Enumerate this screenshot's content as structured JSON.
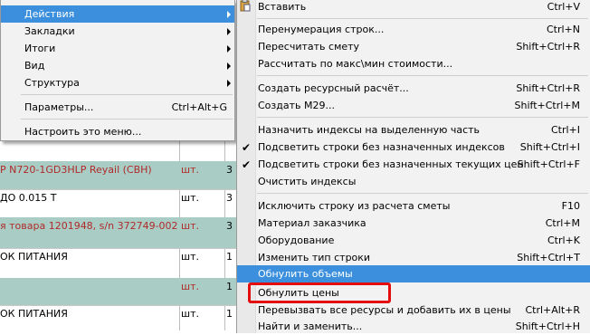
{
  "left_menu": {
    "items": [
      {
        "label": "Действия",
        "shortcut": "",
        "submenu": true,
        "active": true
      },
      {
        "label": "Закладки",
        "shortcut": "",
        "submenu": true
      },
      {
        "label": "Итоги",
        "shortcut": "",
        "submenu": true
      },
      {
        "label": "Вид",
        "shortcut": "",
        "submenu": true
      },
      {
        "label": "Структура",
        "shortcut": "",
        "submenu": true
      },
      {
        "label": "Параметры...",
        "shortcut": "Ctrl+Alt+G"
      },
      {
        "label": "Настроить это меню..."
      }
    ]
  },
  "submenu": {
    "items": [
      {
        "label": "Вставить",
        "shortcut": "Ctrl+V"
      },
      {
        "label": "Перенумерация строк...",
        "shortcut": "Ctrl+N"
      },
      {
        "label": "Пересчитать смету",
        "shortcut": "Shift+Ctrl+R"
      },
      {
        "label": "Рассчитать по макс\\мин стоимости...",
        "shortcut": ""
      },
      {
        "label": "Создать ресурсный расчёт...",
        "shortcut": "Shift+Ctrl+R"
      },
      {
        "label": "Создать М29...",
        "shortcut": "Shift+Ctrl+M"
      },
      {
        "label": "Назначить индексы на выделенную часть",
        "shortcut": "Ctrl+I"
      },
      {
        "label": "Подсветить строки без назначенных индексов",
        "shortcut": "Shift+Ctrl+I"
      },
      {
        "label": "Подсветить строки без назначенных текущих цен",
        "shortcut": "Shift+Ctrl+F"
      },
      {
        "label": "Очистить индексы",
        "shortcut": ""
      },
      {
        "label": "Исключить строку из расчета сметы",
        "shortcut": "F10"
      },
      {
        "label": "Материал заказчика",
        "shortcut": "Ctrl+M"
      },
      {
        "label": "Оборудование",
        "shortcut": "Ctrl+K"
      },
      {
        "label": "Изменить тип строки",
        "shortcut": "Shift+Ctrl+T"
      },
      {
        "label": "Обнулить объемы",
        "shortcut": ""
      },
      {
        "label": "Обнулить цены",
        "shortcut": ""
      },
      {
        "label": "Перевызвать все ресурсы и добавить их в цены",
        "shortcut": "Ctrl+Alt+R"
      },
      {
        "label": "Найти и заменить...",
        "shortcut": "Shift+Ctrl+H"
      }
    ]
  },
  "sheet": {
    "rows": [
      {
        "name": "",
        "unit": "",
        "qty": ""
      },
      {
        "name": "P N720-1GD3HLP Reyail (CBH)",
        "unit": "шт.",
        "qty": "3"
      },
      {
        "name": "ДО 0.015 T",
        "unit": "шт.",
        "qty": "3"
      },
      {
        "name": "я товара 1201948, s/n 372749-002",
        "unit": "шт.",
        "qty": "3"
      },
      {
        "name": "ОК ПИТАНИЯ",
        "unit": "шт.",
        "qty": "1"
      },
      {
        "name": "",
        "unit": "шт.",
        "qty": "1"
      },
      {
        "name": "ОК ПИТАНИЯ",
        "unit": "шт.",
        "qty": "1"
      }
    ]
  },
  "colors": {
    "menu_bg": "#f2f2f2",
    "highlight": "#3b8fdc",
    "row_green": "#a9cdc5",
    "red_text": "#b02a2a",
    "callout": "#e30d0d"
  }
}
